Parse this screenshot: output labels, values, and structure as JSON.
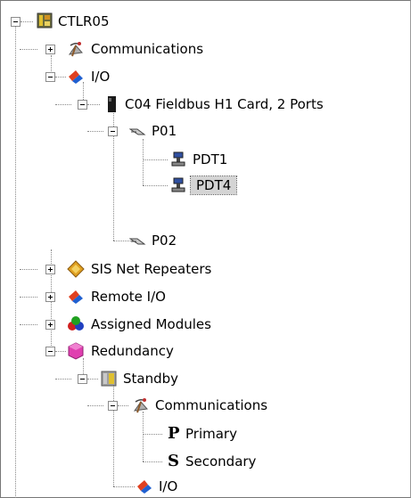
{
  "tree": {
    "root": "CTLR05",
    "communications": "Communications",
    "io": "I/O",
    "card": "C04 Fieldbus H1 Card, 2 Ports",
    "p01": "P01",
    "pdt1": "PDT1",
    "pdt4": "PDT4",
    "p02": "P02",
    "sis": "SIS Net Repeaters",
    "remote_io": "Remote I/O",
    "assigned": "Assigned Modules",
    "redundancy": "Redundancy",
    "standby": "Standby",
    "standby_comms": "Communications",
    "primary_glyph": "P",
    "primary": "Primary",
    "secondary_glyph": "S",
    "secondary": "Secondary",
    "standby_io": "I/O"
  },
  "selected_item": "PDT4"
}
